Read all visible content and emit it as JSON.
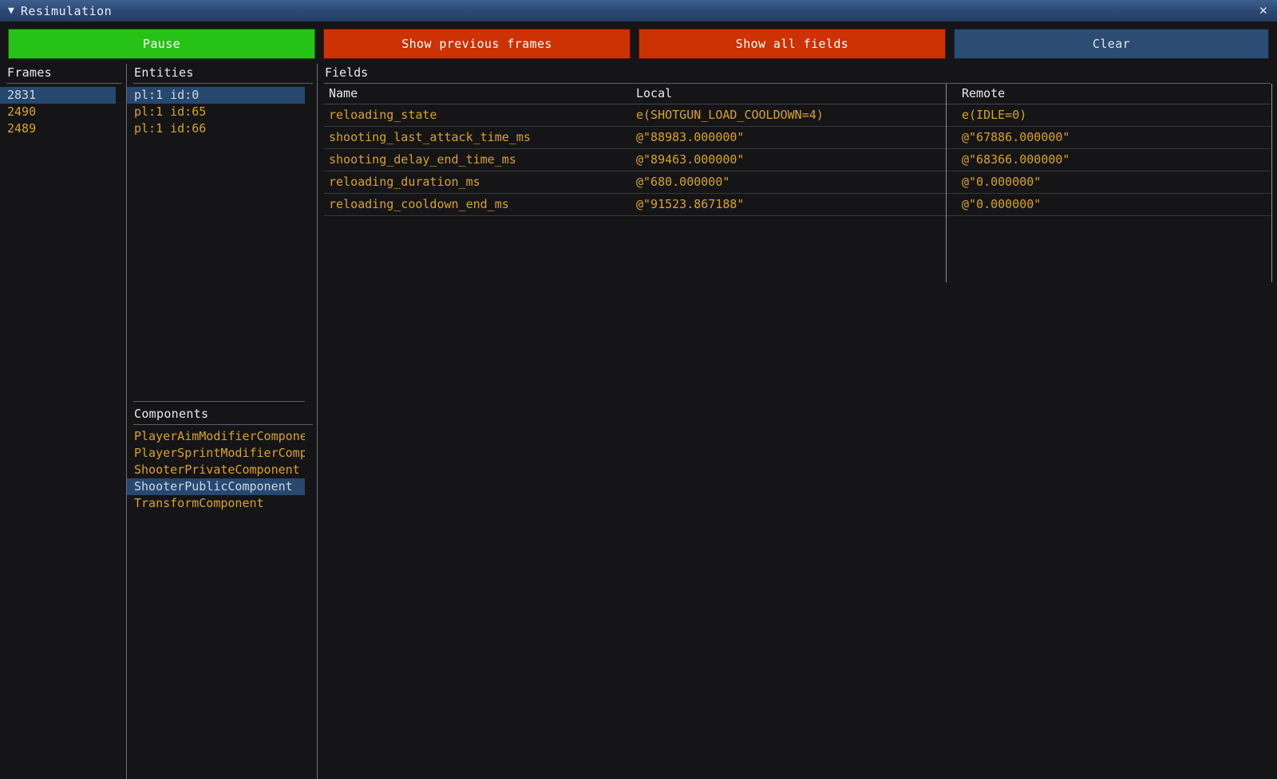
{
  "window": {
    "title": "Resimulation",
    "collapse_icon": "triangle-down-icon",
    "close_icon": "close-icon",
    "close_glyph": "✕",
    "collapse_glyph": "▼",
    "accent_titlebar": "#2c4872"
  },
  "toolbar": {
    "pause_label": "Pause",
    "show_previous_frames_label": "Show previous frames",
    "show_all_fields_label": "Show all fields",
    "clear_label": "Clear",
    "pause_color": "#26c316",
    "show_previous_frames_color": "#cc3204",
    "show_all_fields_color": "#cc3204",
    "clear_color": "#2b4c73"
  },
  "frames": {
    "header": "Frames",
    "items": [
      {
        "label": "2831",
        "selected": true
      },
      {
        "label": "2490",
        "selected": false
      },
      {
        "label": "2489",
        "selected": false
      }
    ]
  },
  "entities": {
    "header": "Entities",
    "items": [
      {
        "label": "pl:1 id:0",
        "selected": true
      },
      {
        "label": "pl:1 id:65",
        "selected": false
      },
      {
        "label": "pl:1 id:66",
        "selected": false
      }
    ]
  },
  "components": {
    "header": "Components",
    "items": [
      {
        "label": "PlayerAimModifierComponent",
        "selected": false
      },
      {
        "label": "PlayerSprintModifierComponent",
        "selected": false
      },
      {
        "label": "ShooterPrivateComponent",
        "selected": false
      },
      {
        "label": "ShooterPublicComponent",
        "selected": true
      },
      {
        "label": "TransformComponent",
        "selected": false
      }
    ]
  },
  "fields": {
    "header": "Fields",
    "columns": [
      "Name",
      "Local",
      "Remote"
    ],
    "rows": [
      {
        "name": "reloading_state",
        "local": "e(SHOTGUN_LOAD_COOLDOWN=4)",
        "remote": "e(IDLE=0)"
      },
      {
        "name": "shooting_last_attack_time_ms",
        "local": "@\"88983.000000\"",
        "remote": "@\"67886.000000\""
      },
      {
        "name": "shooting_delay_end_time_ms",
        "local": "@\"89463.000000\"",
        "remote": "@\"68366.000000\""
      },
      {
        "name": "reloading_duration_ms",
        "local": "@\"680.000000\"",
        "remote": "@\"0.000000\""
      },
      {
        "name": "reloading_cooldown_end_ms",
        "local": "@\"91523.867188\"",
        "remote": "@\"0.000000\""
      }
    ]
  },
  "background": {
    "crosshair_icon": "crosshair-icon",
    "logo_icon": "radiation-logo-icon",
    "value_color": "#d9a227",
    "selection_color": "#27486f"
  }
}
